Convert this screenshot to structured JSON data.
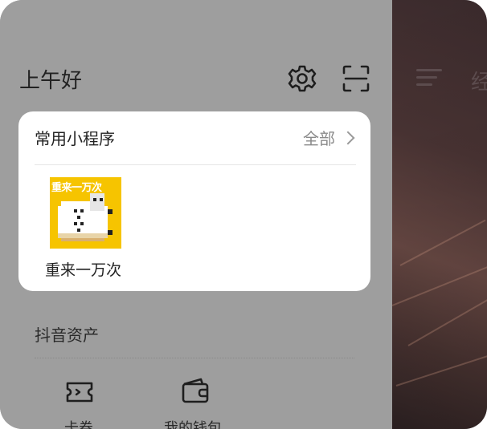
{
  "greeting": "上午好",
  "header": {
    "settings_icon": "gear-icon",
    "scan_icon": "scan-icon"
  },
  "mini_programs": {
    "title": "常用小程序",
    "all_label": "全部",
    "apps": [
      {
        "name": "重来一万次",
        "badge": "重来一万次",
        "icon": "pixel-ghost-app-icon"
      }
    ]
  },
  "assets": {
    "title": "抖音资产",
    "items": [
      {
        "label": "卡券",
        "icon": "ticket-icon"
      },
      {
        "label": "我的钱包",
        "icon": "wallet-icon"
      }
    ]
  },
  "backdrop": {
    "partial_text": "经"
  },
  "colors": {
    "panel_bg": "#9e9e9e",
    "card_bg": "#ffffff",
    "app_yellow": "#f6c400",
    "backdrop": "#4a3434"
  }
}
